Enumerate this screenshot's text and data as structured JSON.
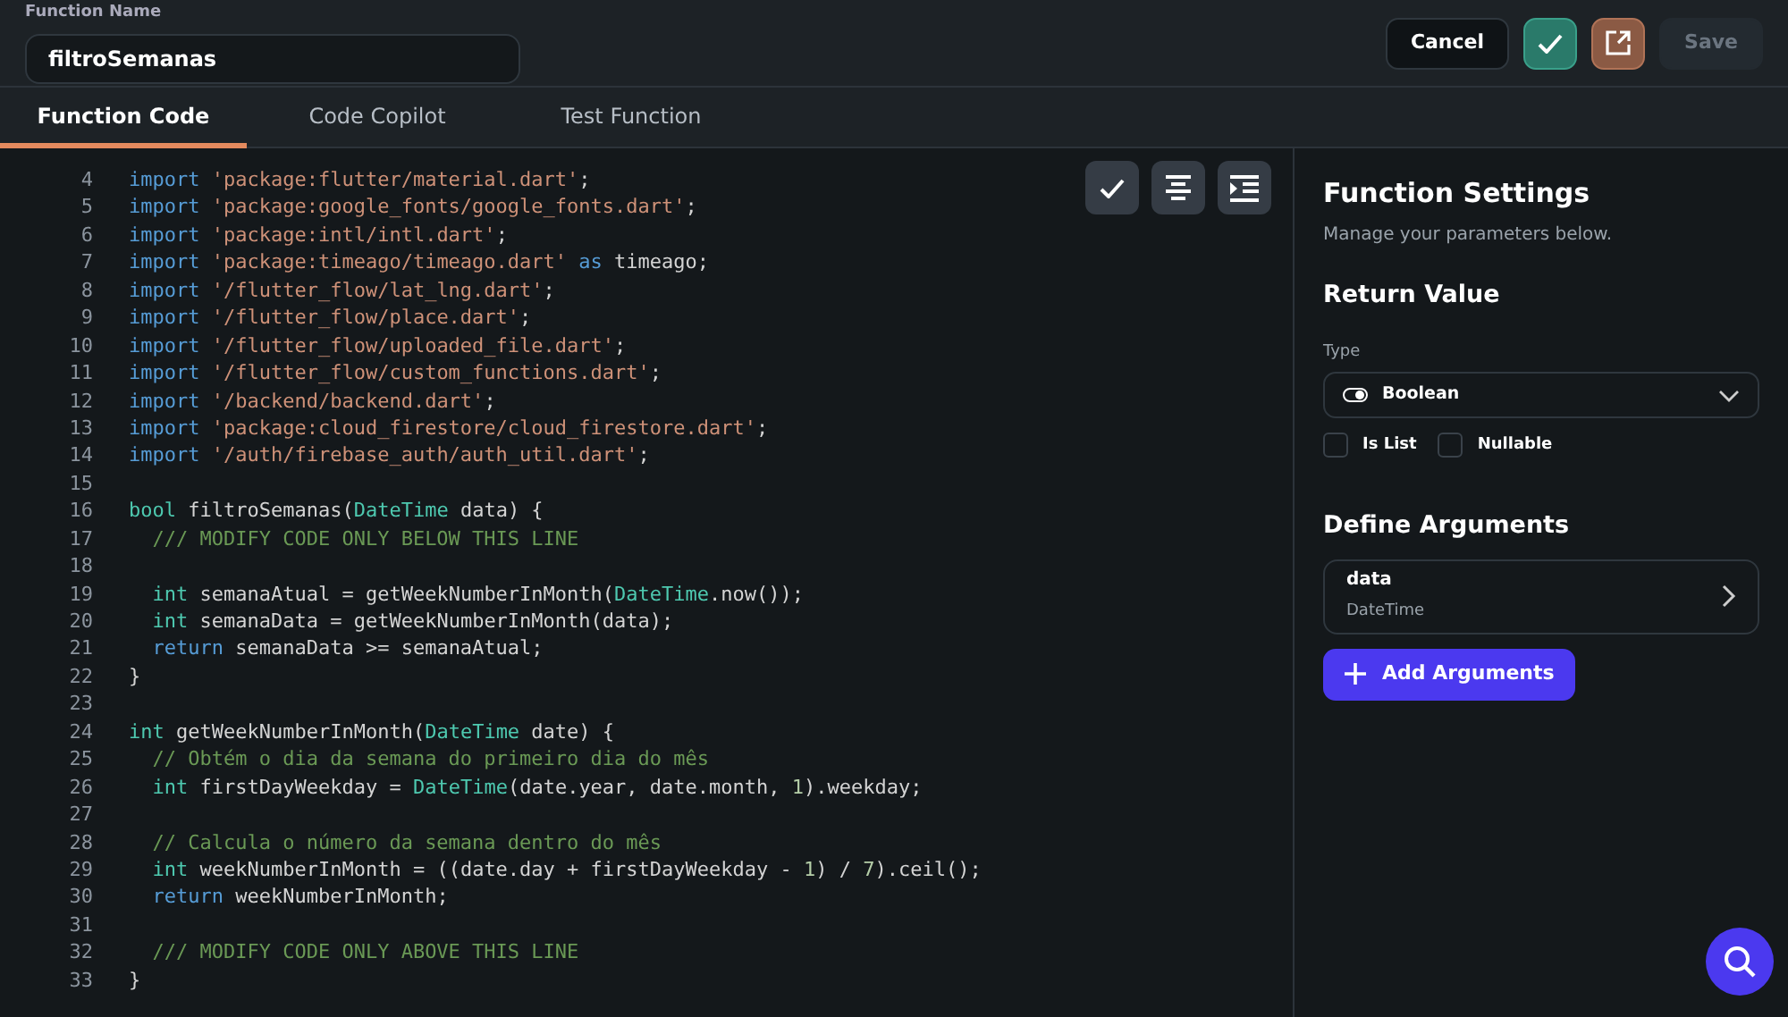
{
  "header": {
    "function_name_label": "Function Name",
    "function_name_value": "filtroSemanas",
    "buttons": [
      {
        "kind": "text",
        "label": "Cancel",
        "disabled": false
      },
      {
        "kind": "check",
        "disabled": false
      },
      {
        "kind": "open",
        "disabled": false
      },
      {
        "kind": "text",
        "label": "Save",
        "disabled": true
      }
    ]
  },
  "tabs": [
    {
      "label": "Function Code",
      "selected": true
    },
    {
      "label": "Code Copilot",
      "selected": false
    },
    {
      "label": "Test Function",
      "selected": false
    }
  ],
  "editor": {
    "toolbar": [
      {
        "kind": "check"
      },
      {
        "kind": "align"
      },
      {
        "kind": "indent"
      }
    ],
    "lines": [
      {
        "number": "4",
        "tokens": [
          {
            "kind": "keyword",
            "text": "import "
          },
          {
            "kind": "string",
            "text": "'package:flutter/material.dart'"
          },
          {
            "kind": "plain",
            "text": ";"
          }
        ]
      },
      {
        "number": "5",
        "tokens": [
          {
            "kind": "keyword",
            "text": "import "
          },
          {
            "kind": "string",
            "text": "'package:google_fonts/google_fonts.dart'"
          },
          {
            "kind": "plain",
            "text": ";"
          }
        ]
      },
      {
        "number": "6",
        "tokens": [
          {
            "kind": "keyword",
            "text": "import "
          },
          {
            "kind": "string",
            "text": "'package:intl/intl.dart'"
          },
          {
            "kind": "plain",
            "text": ";"
          }
        ]
      },
      {
        "number": "7",
        "tokens": [
          {
            "kind": "keyword",
            "text": "import "
          },
          {
            "kind": "string",
            "text": "'package:timeago/timeago.dart'"
          },
          {
            "kind": "keyword",
            "text": " as"
          },
          {
            "kind": "plain",
            "text": " timeago;"
          }
        ]
      },
      {
        "number": "8",
        "tokens": [
          {
            "kind": "keyword",
            "text": "import "
          },
          {
            "kind": "string",
            "text": "'/flutter_flow/lat_lng.dart'"
          },
          {
            "kind": "plain",
            "text": ";"
          }
        ]
      },
      {
        "number": "9",
        "tokens": [
          {
            "kind": "keyword",
            "text": "import "
          },
          {
            "kind": "string",
            "text": "'/flutter_flow/place.dart'"
          },
          {
            "kind": "plain",
            "text": ";"
          }
        ]
      },
      {
        "number": "10",
        "tokens": [
          {
            "kind": "keyword",
            "text": "import "
          },
          {
            "kind": "string",
            "text": "'/flutter_flow/uploaded_file.dart'"
          },
          {
            "kind": "plain",
            "text": ";"
          }
        ]
      },
      {
        "number": "11",
        "tokens": [
          {
            "kind": "keyword",
            "text": "import "
          },
          {
            "kind": "string",
            "text": "'/flutter_flow/custom_functions.dart'"
          },
          {
            "kind": "plain",
            "text": ";"
          }
        ]
      },
      {
        "number": "12",
        "tokens": [
          {
            "kind": "keyword",
            "text": "import "
          },
          {
            "kind": "string",
            "text": "'/backend/backend.dart'"
          },
          {
            "kind": "plain",
            "text": ";"
          }
        ]
      },
      {
        "number": "13",
        "tokens": [
          {
            "kind": "keyword",
            "text": "import "
          },
          {
            "kind": "string",
            "text": "'package:cloud_firestore/cloud_firestore.dart'"
          },
          {
            "kind": "plain",
            "text": ";"
          }
        ]
      },
      {
        "number": "14",
        "tokens": [
          {
            "kind": "keyword",
            "text": "import "
          },
          {
            "kind": "string",
            "text": "'/auth/firebase_auth/auth_util.dart'"
          },
          {
            "kind": "plain",
            "text": ";"
          }
        ]
      },
      {
        "number": "15"
      },
      {
        "number": "16",
        "tokens": [
          {
            "kind": "type",
            "text": "bool"
          },
          {
            "kind": "plain",
            "text": " filtroSemanas("
          },
          {
            "kind": "type",
            "text": "DateTime"
          },
          {
            "kind": "plain",
            "text": " data) {"
          }
        ]
      },
      {
        "number": "17",
        "tokens": [
          {
            "kind": "comment",
            "text": "  /// MODIFY CODE ONLY BELOW THIS LINE"
          }
        ]
      },
      {
        "number": "18"
      },
      {
        "number": "19",
        "tokens": [
          {
            "kind": "type",
            "text": "  int"
          },
          {
            "kind": "plain",
            "text": " semanaAtual = getWeekNumberInMonth("
          },
          {
            "kind": "type",
            "text": "DateTime"
          },
          {
            "kind": "plain",
            "text": ".now());"
          }
        ]
      },
      {
        "number": "20",
        "tokens": [
          {
            "kind": "type",
            "text": "  int"
          },
          {
            "kind": "plain",
            "text": " semanaData = getWeekNumberInMonth(data);"
          }
        ]
      },
      {
        "number": "21",
        "tokens": [
          {
            "kind": "keyword",
            "text": "  return"
          },
          {
            "kind": "plain",
            "text": " semanaData >= semanaAtual;"
          }
        ]
      },
      {
        "number": "22",
        "tokens": [
          {
            "kind": "plain",
            "text": "}"
          }
        ]
      },
      {
        "number": "23"
      },
      {
        "number": "24",
        "tokens": [
          {
            "kind": "type",
            "text": "int"
          },
          {
            "kind": "plain",
            "text": " getWeekNumberInMonth("
          },
          {
            "kind": "type",
            "text": "DateTime"
          },
          {
            "kind": "plain",
            "text": " date) {"
          }
        ]
      },
      {
        "number": "25",
        "tokens": [
          {
            "kind": "comment",
            "text": "  // Obtém o dia da semana do primeiro dia do mês"
          }
        ]
      },
      {
        "number": "26",
        "tokens": [
          {
            "kind": "type",
            "text": "  int"
          },
          {
            "kind": "plain",
            "text": " firstDayWeekday = "
          },
          {
            "kind": "type",
            "text": "DateTime"
          },
          {
            "kind": "plain",
            "text": "(date.year, date.month, "
          },
          {
            "kind": "number",
            "text": "1"
          },
          {
            "kind": "plain",
            "text": ").weekday;"
          }
        ]
      },
      {
        "number": "27"
      },
      {
        "number": "28",
        "tokens": [
          {
            "kind": "comment",
            "text": "  // Calcula o número da semana dentro do mês"
          }
        ]
      },
      {
        "number": "29",
        "tokens": [
          {
            "kind": "type",
            "text": "  int"
          },
          {
            "kind": "plain",
            "text": " weekNumberInMonth = ((date.day + firstDayWeekday - "
          },
          {
            "kind": "number",
            "text": "1"
          },
          {
            "kind": "plain",
            "text": ") / "
          },
          {
            "kind": "number",
            "text": "7"
          },
          {
            "kind": "plain",
            "text": ").ceil();"
          }
        ]
      },
      {
        "number": "30",
        "tokens": [
          {
            "kind": "keyword",
            "text": "  return"
          },
          {
            "kind": "plain",
            "text": " weekNumberInMonth;"
          }
        ]
      },
      {
        "number": "31"
      },
      {
        "number": "32",
        "tokens": [
          {
            "kind": "comment",
            "text": "  /// MODIFY CODE ONLY ABOVE THIS LINE"
          }
        ]
      },
      {
        "number": "33",
        "tokens": [
          {
            "kind": "plain",
            "text": "}"
          }
        ]
      }
    ]
  },
  "settings": {
    "title": "Function Settings",
    "subtitle": "Manage your parameters below.",
    "return_heading": "Return Value",
    "type_label": "Type",
    "type_value": "Boolean",
    "checkboxes": [
      {
        "label": "Is List",
        "checked": false
      },
      {
        "label": "Nullable",
        "checked": false
      }
    ],
    "arguments_heading": "Define Arguments",
    "arguments": [
      {
        "name": "data",
        "type": "DateTime"
      }
    ],
    "add_button": "Add Arguments"
  }
}
